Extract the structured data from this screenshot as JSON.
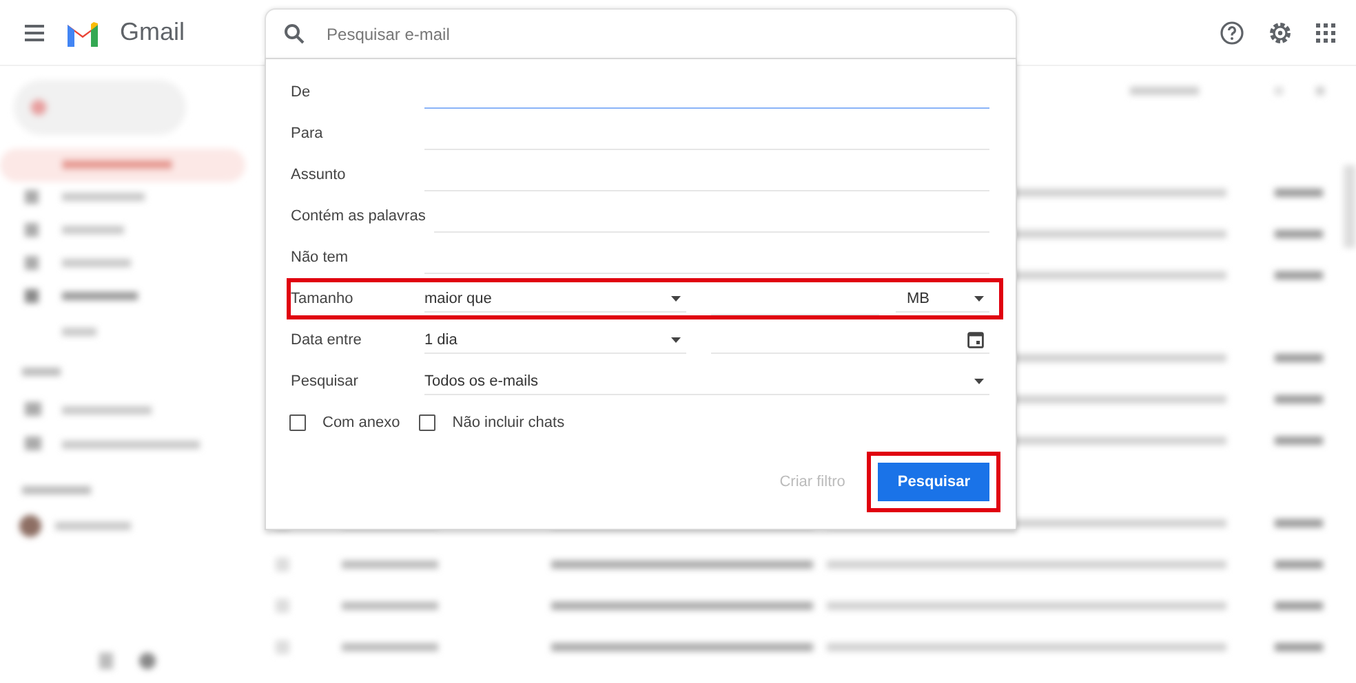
{
  "header": {
    "app_name": "Gmail",
    "search": {
      "placeholder": "Pesquisar e-mail"
    }
  },
  "search_options": {
    "rows": [
      {
        "kind": "text",
        "label": "De",
        "focused": true
      },
      {
        "kind": "text",
        "label": "Para",
        "focused": false
      },
      {
        "kind": "text",
        "label": "Assunto",
        "focused": false
      },
      {
        "kind": "text",
        "label": "Contém as palavras",
        "focused": false
      },
      {
        "kind": "text",
        "label": "Não tem",
        "focused": false
      },
      {
        "kind": "size",
        "label": "Tamanho",
        "comparison": "maior que",
        "unit": "MB",
        "highlighted": true
      },
      {
        "kind": "date",
        "label": "Data entre",
        "range": "1 dia"
      },
      {
        "kind": "select",
        "label": "Pesquisar",
        "value": "Todos os e-mails"
      }
    ],
    "checkboxes": [
      {
        "label": "Com anexo",
        "checked": false
      },
      {
        "label": "Não incluir chats",
        "checked": false
      }
    ],
    "create_filter": {
      "label": "Criar filtro",
      "disabled": true
    },
    "search_button": {
      "label": "Pesquisar",
      "highlighted": true
    }
  }
}
